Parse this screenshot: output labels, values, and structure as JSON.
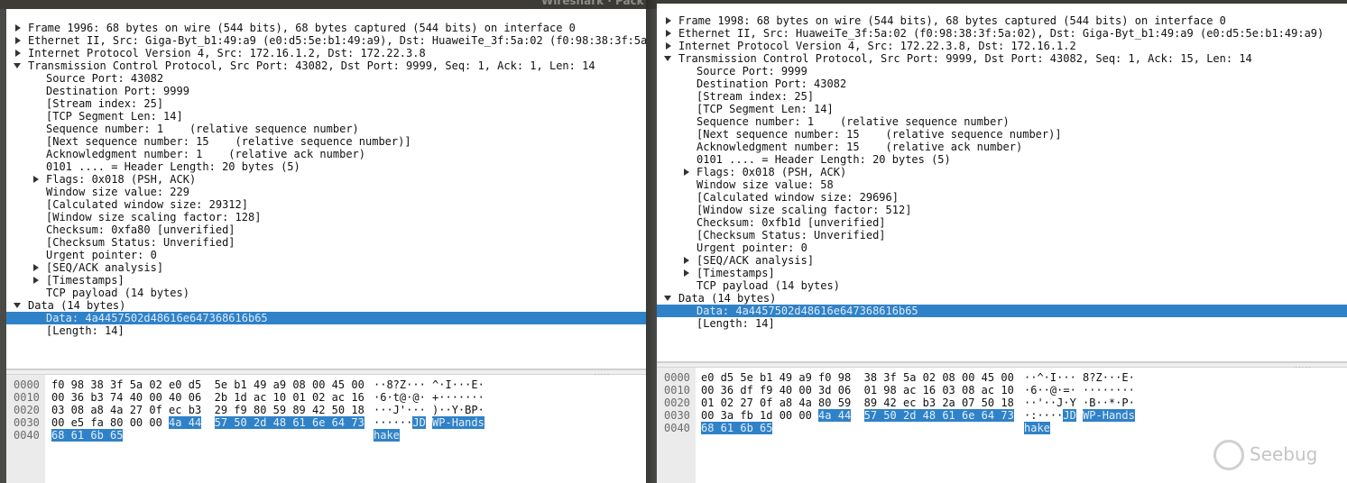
{
  "window": {
    "title": "Wireshark · Pack"
  },
  "left": {
    "tree": [
      {
        "text": "Frame 1996: 68 bytes on wire (544 bits), 68 bytes captured (544 bits) on interface 0",
        "level": 0,
        "arrow": "right"
      },
      {
        "text": "Ethernet II, Src: Giga-Byt_b1:49:a9 (e0:d5:5e:b1:49:a9), Dst: HuaweiTe_3f:5a:02 (f0:98:38:3f:5a",
        "level": 0,
        "arrow": "right"
      },
      {
        "text": "Internet Protocol Version 4, Src: 172.16.1.2, Dst: 172.22.3.8",
        "level": 0,
        "arrow": "right"
      },
      {
        "text": "Transmission Control Protocol, Src Port: 43082, Dst Port: 9999, Seq: 1, Ack: 1, Len: 14",
        "level": 0,
        "arrow": "down"
      },
      {
        "text": "Source Port: 43082",
        "level": 1,
        "arrow": ""
      },
      {
        "text": "Destination Port: 9999",
        "level": 1,
        "arrow": ""
      },
      {
        "text": "[Stream index: 25]",
        "level": 1,
        "arrow": ""
      },
      {
        "text": "[TCP Segment Len: 14]",
        "level": 1,
        "arrow": ""
      },
      {
        "text": "Sequence number: 1    (relative sequence number)",
        "level": 1,
        "arrow": ""
      },
      {
        "text": "[Next sequence number: 15    (relative sequence number)]",
        "level": 1,
        "arrow": ""
      },
      {
        "text": "Acknowledgment number: 1    (relative ack number)",
        "level": 1,
        "arrow": ""
      },
      {
        "text": "0101 .... = Header Length: 20 bytes (5)",
        "level": 1,
        "arrow": ""
      },
      {
        "text": "Flags: 0x018 (PSH, ACK)",
        "level": 1,
        "arrow": "right"
      },
      {
        "text": "Window size value: 229",
        "level": 1,
        "arrow": ""
      },
      {
        "text": "[Calculated window size: 29312]",
        "level": 1,
        "arrow": ""
      },
      {
        "text": "[Window size scaling factor: 128]",
        "level": 1,
        "arrow": ""
      },
      {
        "text": "Checksum: 0xfa80 [unverified]",
        "level": 1,
        "arrow": ""
      },
      {
        "text": "[Checksum Status: Unverified]",
        "level": 1,
        "arrow": ""
      },
      {
        "text": "Urgent pointer: 0",
        "level": 1,
        "arrow": ""
      },
      {
        "text": "[SEQ/ACK analysis]",
        "level": 1,
        "arrow": "right"
      },
      {
        "text": "[Timestamps]",
        "level": 1,
        "arrow": "right"
      },
      {
        "text": "TCP payload (14 bytes)",
        "level": 1,
        "arrow": ""
      },
      {
        "text": "Data (14 bytes)",
        "level": 0,
        "arrow": "down"
      },
      {
        "text": "Data: 4a4457502d48616e647368616b65",
        "level": 1,
        "arrow": "",
        "selected": true
      },
      {
        "text": "[Length: 14]",
        "level": 1,
        "arrow": ""
      }
    ],
    "hex": [
      {
        "offset": "0000",
        "b1": "f0 98 38 3f 5a 02 e0 d5",
        "b2": "5e b1 49 a9 08 00 45 00",
        "a1": "··8?Z···",
        "a2": "^·I···E·"
      },
      {
        "offset": "0010",
        "b1": "00 36 b3 74 40 00 40 06",
        "b2": "2b 1d ac 10 01 02 ac 16",
        "a1": "·6·t@·@·",
        "a2": "+·······"
      },
      {
        "offset": "0020",
        "b1": "03 08 a8 4a 27 0f ec b3",
        "b2": "29 f9 80 59 89 42 50 18",
        "a1": "···J'···",
        "a2": ")··Y·BP·"
      },
      {
        "offset": "0030",
        "b1": "00 e5 fa 80 00 00 ",
        "b1h": "4a 44",
        "b2pre": "",
        "b2h": "57 50 2d 48 61 6e 64 73",
        "a1": "······",
        "a1h": "JD",
        "a2h": "WP-Hands"
      },
      {
        "offset": "0040",
        "b1h": "68 61 6b 65",
        "a1h": "hake"
      }
    ]
  },
  "right": {
    "tree": [
      {
        "text": "Frame 1998: 68 bytes on wire (544 bits), 68 bytes captured (544 bits) on interface 0",
        "level": 0,
        "arrow": "right"
      },
      {
        "text": "Ethernet II, Src: HuaweiTe_3f:5a:02 (f0:98:38:3f:5a:02), Dst: Giga-Byt_b1:49:a9 (e0:d5:5e:b1:49:a9)",
        "level": 0,
        "arrow": "right"
      },
      {
        "text": "Internet Protocol Version 4, Src: 172.22.3.8, Dst: 172.16.1.2",
        "level": 0,
        "arrow": "right"
      },
      {
        "text": "Transmission Control Protocol, Src Port: 9999, Dst Port: 43082, Seq: 1, Ack: 15, Len: 14",
        "level": 0,
        "arrow": "down"
      },
      {
        "text": "Source Port: 9999",
        "level": 1,
        "arrow": ""
      },
      {
        "text": "Destination Port: 43082",
        "level": 1,
        "arrow": ""
      },
      {
        "text": "[Stream index: 25]",
        "level": 1,
        "arrow": ""
      },
      {
        "text": "[TCP Segment Len: 14]",
        "level": 1,
        "arrow": ""
      },
      {
        "text": "Sequence number: 1    (relative sequence number)",
        "level": 1,
        "arrow": ""
      },
      {
        "text": "[Next sequence number: 15    (relative sequence number)]",
        "level": 1,
        "arrow": ""
      },
      {
        "text": "Acknowledgment number: 15    (relative ack number)",
        "level": 1,
        "arrow": ""
      },
      {
        "text": "0101 .... = Header Length: 20 bytes (5)",
        "level": 1,
        "arrow": ""
      },
      {
        "text": "Flags: 0x018 (PSH, ACK)",
        "level": 1,
        "arrow": "right"
      },
      {
        "text": "Window size value: 58",
        "level": 1,
        "arrow": ""
      },
      {
        "text": "[Calculated window size: 29696]",
        "level": 1,
        "arrow": ""
      },
      {
        "text": "[Window size scaling factor: 512]",
        "level": 1,
        "arrow": ""
      },
      {
        "text": "Checksum: 0xfb1d [unverified]",
        "level": 1,
        "arrow": ""
      },
      {
        "text": "[Checksum Status: Unverified]",
        "level": 1,
        "arrow": ""
      },
      {
        "text": "Urgent pointer: 0",
        "level": 1,
        "arrow": ""
      },
      {
        "text": "[SEQ/ACK analysis]",
        "level": 1,
        "arrow": "right"
      },
      {
        "text": "[Timestamps]",
        "level": 1,
        "arrow": "right"
      },
      {
        "text": "TCP payload (14 bytes)",
        "level": 1,
        "arrow": ""
      },
      {
        "text": "Data (14 bytes)",
        "level": 0,
        "arrow": "down"
      },
      {
        "text": "Data: 4a4457502d48616e647368616b65",
        "level": 1,
        "arrow": "",
        "selected": true
      },
      {
        "text": "[Length: 14]",
        "level": 1,
        "arrow": ""
      }
    ],
    "hex": [
      {
        "offset": "0000",
        "b1": "e0 d5 5e b1 49 a9 f0 98",
        "b2": "38 3f 5a 02 08 00 45 00",
        "a1": "··^·I···",
        "a2": "8?Z···E·"
      },
      {
        "offset": "0010",
        "b1": "00 36 df f9 40 00 3d 06",
        "b2": "01 98 ac 16 03 08 ac 10",
        "a1": "·6··@·=·",
        "a2": "········"
      },
      {
        "offset": "0020",
        "b1": "01 02 27 0f a8 4a 80 59",
        "b2": "89 42 ec b3 2a 07 50 18",
        "a1": "··'··J·Y",
        "a2": "·B··*·P·"
      },
      {
        "offset": "0030",
        "b1": "00 3a fb 1d 00 00 ",
        "b1h": "4a 44",
        "b2pre": "",
        "b2h": "57 50 2d 48 61 6e 64 73",
        "a1": "·:····",
        "a1h": "JD",
        "a2h": "WP-Hands"
      },
      {
        "offset": "0040",
        "b1h": "68 61 6b 65",
        "a1h": "hake"
      }
    ]
  },
  "watermark": {
    "text": "Seebug"
  },
  "colors": {
    "selection": "#2f82c8",
    "gutter": "#ebebeb",
    "background": "#4a4a47"
  }
}
